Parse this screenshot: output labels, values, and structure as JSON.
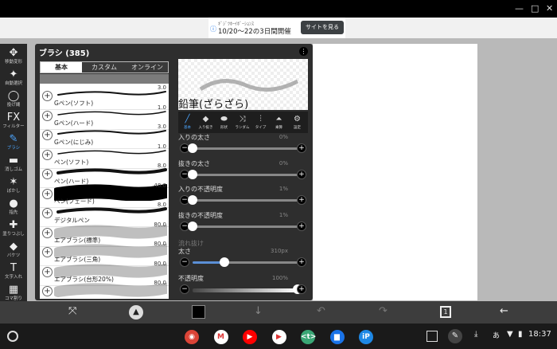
{
  "window": {
    "minimize": "—",
    "restore": "□",
    "close": "✕"
  },
  "ad": {
    "small": "ｷﾞｼﾞﾂﾎｰｲﾎﾞｰｼｮﾝｽ",
    "main": "10/20〜22の3日間開催",
    "button": "サイトを見る"
  },
  "tools": [
    {
      "icon": "move-icon",
      "glyph": "✥",
      "label": "移動変形"
    },
    {
      "icon": "magic-wand-icon",
      "glyph": "✦",
      "label": "自動選択"
    },
    {
      "icon": "lasso-icon",
      "glyph": "◯",
      "label": "投げ縄"
    },
    {
      "icon": "filter-icon",
      "glyph": "FX",
      "label": "フィルター"
    },
    {
      "icon": "brush-icon",
      "glyph": "✎",
      "label": "ブラシ",
      "active": true
    },
    {
      "icon": "eraser-icon",
      "glyph": "▬",
      "label": "消しゴム"
    },
    {
      "icon": "blur-icon",
      "glyph": "✶",
      "label": "ぼかし"
    },
    {
      "icon": "smudge-icon",
      "glyph": "●",
      "label": "指先"
    },
    {
      "icon": "fill-icon",
      "glyph": "✚",
      "label": "塗りつぶし"
    },
    {
      "icon": "bucket-icon",
      "glyph": "◆",
      "label": "バケツ"
    },
    {
      "icon": "text-icon",
      "glyph": "T",
      "label": "文字入れ"
    },
    {
      "icon": "frame-icon",
      "glyph": "▦",
      "label": "コマ割り"
    },
    {
      "icon": "eyedropper-icon",
      "glyph": "✒",
      "label": "スポイト"
    }
  ],
  "panel": {
    "title": "ブラシ (385)",
    "tabs": [
      "基本",
      "カスタム",
      "オンライン"
    ],
    "brushes": [
      {
        "name": "Gペン(ソフト)",
        "size": "3.0",
        "w": 2
      },
      {
        "name": "Gペン(ハード)",
        "size": "1.0",
        "w": 1.5
      },
      {
        "name": "Gペン(にじみ)",
        "size": "3.0",
        "w": 2
      },
      {
        "name": "ペン(ソフト)",
        "size": "1.0",
        "w": 1.5
      },
      {
        "name": "ペン(ハード)",
        "size": "8.0",
        "w": 4
      },
      {
        "name": "ペン(フェード)",
        "size": "48.0",
        "w": 18
      },
      {
        "name": "デジタルペン",
        "size": "8.0",
        "w": 4
      },
      {
        "name": "エアブラシ(標準)",
        "size": "80.0",
        "w": 14
      },
      {
        "name": "エアブラシ(三角)",
        "size": "80.0",
        "w": 14
      },
      {
        "name": "エアブラシ(台形20%)",
        "size": "80.0",
        "w": 14
      },
      {
        "name": "",
        "size": "80.0",
        "w": 14
      }
    ],
    "selected_brush": "鉛筆(ざらざら)",
    "categories": [
      {
        "icon": "basic-icon",
        "glyph": "╱",
        "label": "基本",
        "active": true
      },
      {
        "icon": "start-end-icon",
        "glyph": "◆",
        "label": "入り抜き"
      },
      {
        "icon": "shape-icon",
        "glyph": "⬬",
        "label": "形状"
      },
      {
        "icon": "random-icon",
        "glyph": "⤨",
        "label": "ランダム"
      },
      {
        "icon": "type-icon",
        "glyph": "⫶",
        "label": "タイプ"
      },
      {
        "icon": "blend-icon",
        "glyph": "⏶",
        "label": "乗算"
      },
      {
        "icon": "settings-icon",
        "glyph": "⚙",
        "label": "設定"
      }
    ],
    "settings": [
      {
        "label": "入りの太さ",
        "value": "0%",
        "level": 0
      },
      {
        "label": "抜きの太さ",
        "value": "0%",
        "level": 0
      },
      {
        "label": "入りの不透明度",
        "value": "1%",
        "level": 0
      },
      {
        "label": "抜きの不透明度",
        "value": "1%",
        "level": 0
      }
    ],
    "hidden_label": "流れ抜け",
    "thickness": {
      "label": "太さ",
      "value": "310px",
      "level": 0.3
    },
    "opacity": {
      "label": "不透明度",
      "value": "100%",
      "level": 1
    }
  },
  "appbar": [
    "transform-icon",
    "brush-shape-icon",
    "color-swatch",
    "down-arrow-icon",
    "undo-icon",
    "redo-icon",
    "layers-icon",
    "back-icon"
  ],
  "shelf": {
    "apps": [
      {
        "name": "chrome-icon",
        "color": "#db4437",
        "glyph": "◉"
      },
      {
        "name": "gmail-icon",
        "color": "#ffffff",
        "glyph": "M"
      },
      {
        "name": "youtube-icon",
        "color": "#ff0000",
        "glyph": "▶"
      },
      {
        "name": "play-store-icon",
        "color": "#ffffff",
        "glyph": "▶"
      },
      {
        "name": "terminal-icon",
        "color": "#3aa675",
        "glyph": "<t>"
      },
      {
        "name": "files-icon",
        "color": "#1a73e8",
        "glyph": "▆"
      },
      {
        "name": "ibis-paint-icon",
        "color": "#1e88e5",
        "glyph": "iP"
      }
    ],
    "time": "18:37"
  }
}
